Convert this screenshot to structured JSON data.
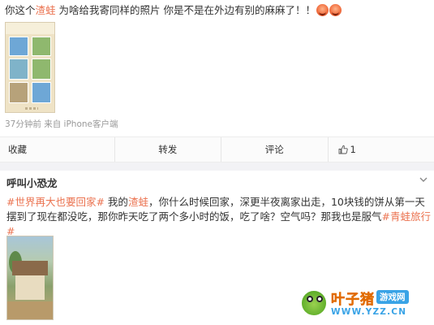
{
  "post1": {
    "text_prefix": "你这个",
    "mention": "渣蛙",
    "text_suffix": " 为啥给我寄同样的照片 你是不是在外边有别的麻麻了！！",
    "emoji": [
      "angry-face-emoji",
      "angry-face-emoji"
    ],
    "meta": "37分钟前 来自 iPhone客户端"
  },
  "actions": {
    "favorite": "收藏",
    "repost": "转发",
    "comment": "评论",
    "like_count": "1"
  },
  "post2": {
    "username": "呼叫小恐龙",
    "tag1": "#世界再大也要回家#",
    "text1": " 我的",
    "mention": "渣蛙",
    "text2": "，你什么时候回家，深更半夜离家出走，10块钱的饼从第一天摆到了现在都没吃，那你昨天吃了两个多小时的饭，吃了啥？空气吗？那我也是服气",
    "tag2": "#青蛙旅行#"
  },
  "watermark": {
    "brand": "叶子猪",
    "badge": "游戏网",
    "url": "WWW.YZZ.CN"
  },
  "colors": {
    "accent": "#eb7350",
    "muted": "#999999",
    "watermark_orange": "#ff8a1f",
    "watermark_blue": "#39a3e6"
  }
}
